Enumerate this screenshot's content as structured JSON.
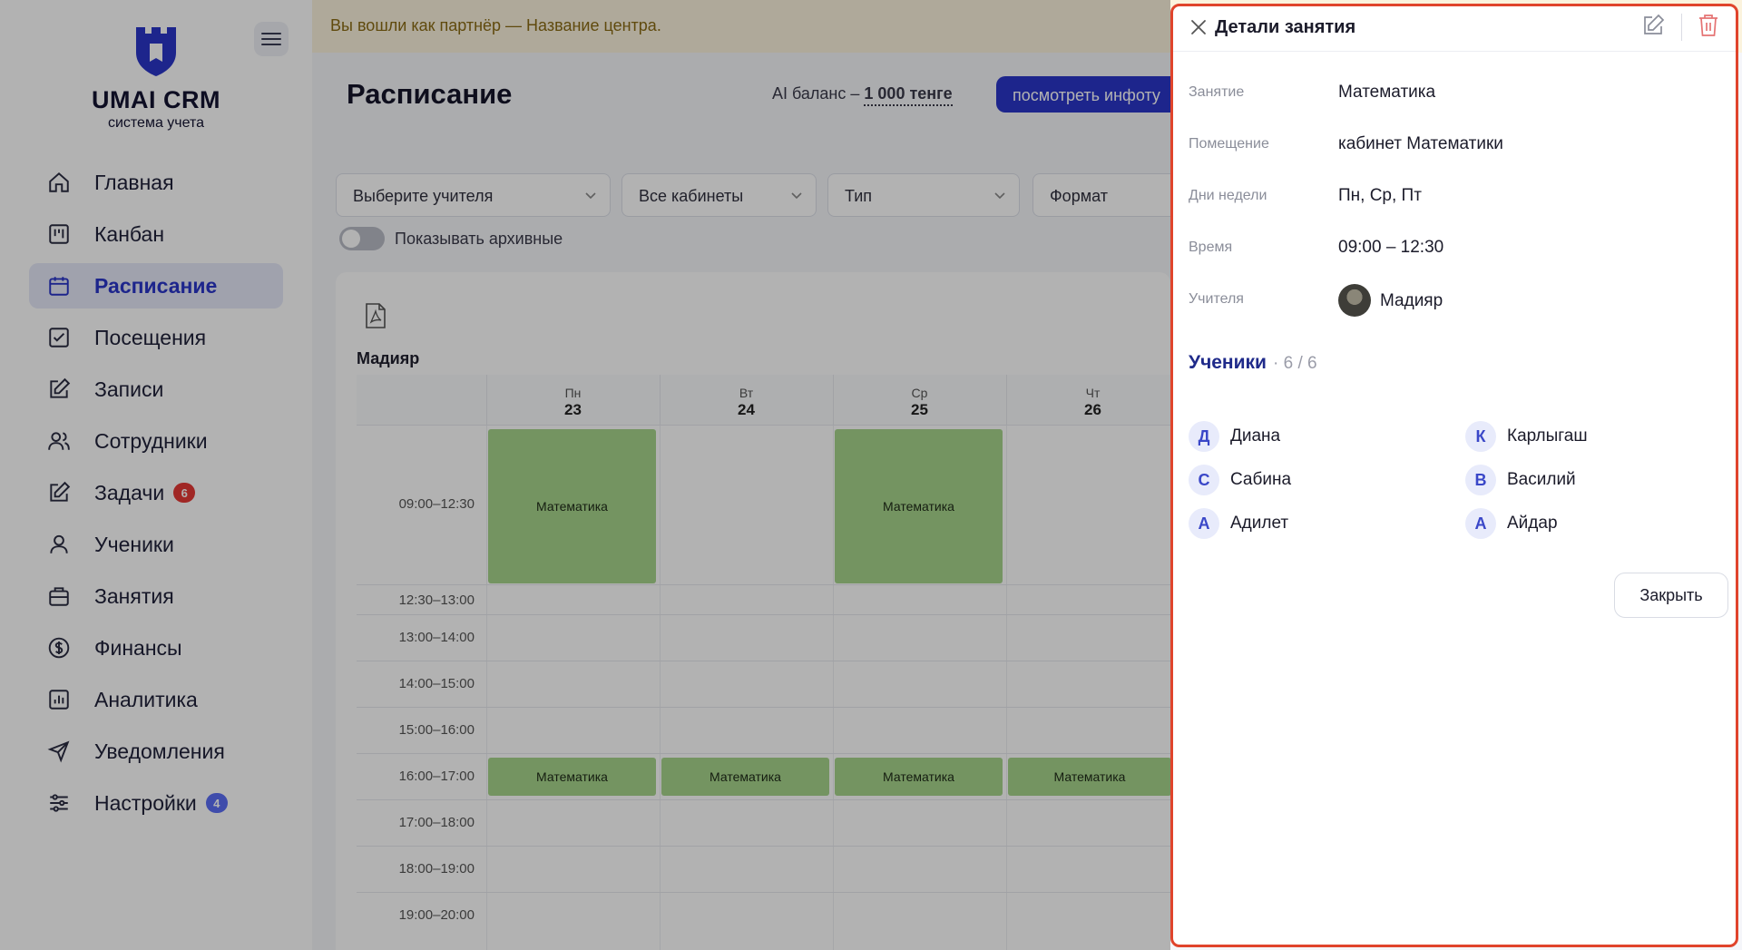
{
  "sidebar": {
    "brand": "UMAI CRM",
    "subtitle": "система учета",
    "items": [
      {
        "label": "Главная"
      },
      {
        "label": "Канбан"
      },
      {
        "label": "Расписание"
      },
      {
        "label": "Посещения"
      },
      {
        "label": "Записи"
      },
      {
        "label": "Сотрудники"
      },
      {
        "label": "Задачи",
        "badge": "6"
      },
      {
        "label": "Ученики"
      },
      {
        "label": "Занятия"
      },
      {
        "label": "Финансы"
      },
      {
        "label": "Аналитика"
      },
      {
        "label": "Уведомления"
      },
      {
        "label": "Настройки",
        "badge": "4"
      }
    ]
  },
  "banner": "Вы вошли как партнёр — Название центра.",
  "header": {
    "title": "Расписание",
    "ai_balance_prefix": "AI баланс –",
    "ai_balance_value": "1 000 тенге",
    "info_button": "посмотреть инфоту"
  },
  "filters": {
    "teacher": "Выберите учителя",
    "rooms": "Все кабинеты",
    "type": "Тип",
    "format": "Формат",
    "archive_toggle": "Показывать архивные"
  },
  "schedule": {
    "teacher": "Мадияр",
    "days": [
      {
        "name": "Пн",
        "date": "23"
      },
      {
        "name": "Вт",
        "date": "24"
      },
      {
        "name": "Ср",
        "date": "25"
      },
      {
        "name": "Чт",
        "date": "26"
      }
    ],
    "times": [
      "09:00–12:30",
      "12:30–13:00",
      "13:00–14:00",
      "14:00–15:00",
      "15:00–16:00",
      "16:00–17:00",
      "17:00–18:00",
      "18:00–19:00",
      "19:00–20:00"
    ],
    "lesson_label": "Математика"
  },
  "panel": {
    "title": "Детали занятия",
    "fields": {
      "lesson_label": "Занятие",
      "lesson_value": "Математика",
      "room_label": "Помещение",
      "room_value": "кабинет Математики",
      "days_label": "Дни недели",
      "days_value": "Пн, Ср, Пт",
      "time_label": "Время",
      "time_value": "09:00 – 12:30",
      "teachers_label": "Учителя",
      "teacher_value": "Мадияр"
    },
    "students_title": "Ученики",
    "students_count": "· 6 / 6",
    "students": [
      {
        "initial": "Д",
        "name": "Диана"
      },
      {
        "initial": "К",
        "name": "Карлыгаш"
      },
      {
        "initial": "С",
        "name": "Сабина"
      },
      {
        "initial": "В",
        "name": "Василий"
      },
      {
        "initial": "А",
        "name": "Адилет"
      },
      {
        "initial": "А",
        "name": "Айдар"
      }
    ],
    "close_button": "Закрыть"
  },
  "colors": {
    "accent": "#2a35c9",
    "lesson": "#a6d48c",
    "highlight_border": "#e0442c",
    "badge_red": "#e53935",
    "badge_blue": "#5b6ef5"
  }
}
